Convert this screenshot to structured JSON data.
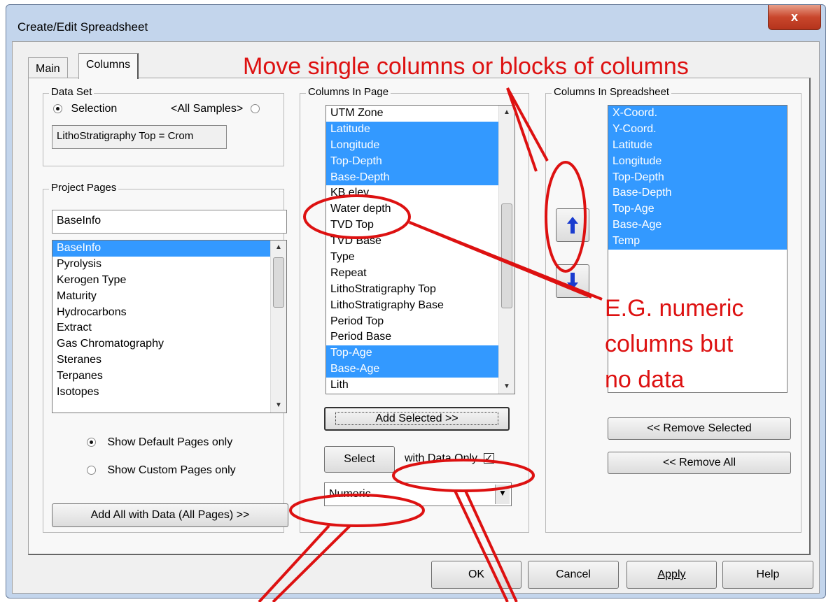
{
  "window": {
    "title": "Create/Edit Spreadsheet",
    "close_label": "x"
  },
  "tabs": {
    "main": "Main",
    "columns": "Columns"
  },
  "data_set": {
    "label": "Data Set",
    "selection_label": "Selection",
    "all_samples_label": "<All Samples>",
    "selection_value": "LithoStratigraphy Top = Crom"
  },
  "project_pages": {
    "label": "Project Pages",
    "filter_value": "BaseInfo",
    "items": [
      "BaseInfo",
      "Pyrolysis",
      "Kerogen Type",
      "Maturity",
      "Hydrocarbons",
      "Extract",
      "Gas Chromatography",
      "Steranes",
      "Terpanes",
      "Isotopes"
    ],
    "show_default_label": "Show Default Pages only",
    "show_custom_label": "Show Custom Pages only",
    "add_all_label": "Add All with Data (All Pages) >>"
  },
  "columns_in_page": {
    "label": "Columns In Page",
    "items": [
      "UTM Zone",
      "Latitude",
      "Longitude",
      "Top-Depth",
      "Base-Depth",
      "KB elev",
      "Water depth",
      "TVD Top",
      "TVD Base",
      "Type",
      "Repeat",
      "LithoStratigraphy Top",
      "LithoStratigraphy Base",
      "Period Top",
      "Period Base",
      "Top-Age",
      "Base-Age",
      "Lith"
    ],
    "add_selected_label": "Add Selected >>",
    "select_label": "Select",
    "with_data_only_label": "with Data Only",
    "with_data_only_checked": "✓",
    "type_filter_value": "Numeric"
  },
  "columns_in_spreadsheet": {
    "label": "Columns In Spreadsheet",
    "items": [
      "X-Coord.",
      "Y-Coord.",
      "Latitude",
      "Longitude",
      "Top-Depth",
      "Base-Depth",
      "Top-Age",
      "Base-Age",
      "Temp"
    ],
    "move_up_icon": "arrow-up-icon",
    "move_down_icon": "arrow-down-icon",
    "remove_selected_label": "<< Remove Selected",
    "remove_all_label": "<< Remove All"
  },
  "footer": {
    "ok_label": "OK",
    "cancel_label": "Cancel",
    "apply_label": "Apply",
    "help_label": "Help"
  },
  "annotations": {
    "move_note": "Move single columns or blocks of columns",
    "numeric_note_line1": "E.G. numeric",
    "numeric_note_line2": "columns but",
    "numeric_note_line3": "no data"
  },
  "colors": {
    "selection": "#3399ff",
    "annotation": "#dd1111",
    "arrow_icon": "#1a3ccf"
  }
}
